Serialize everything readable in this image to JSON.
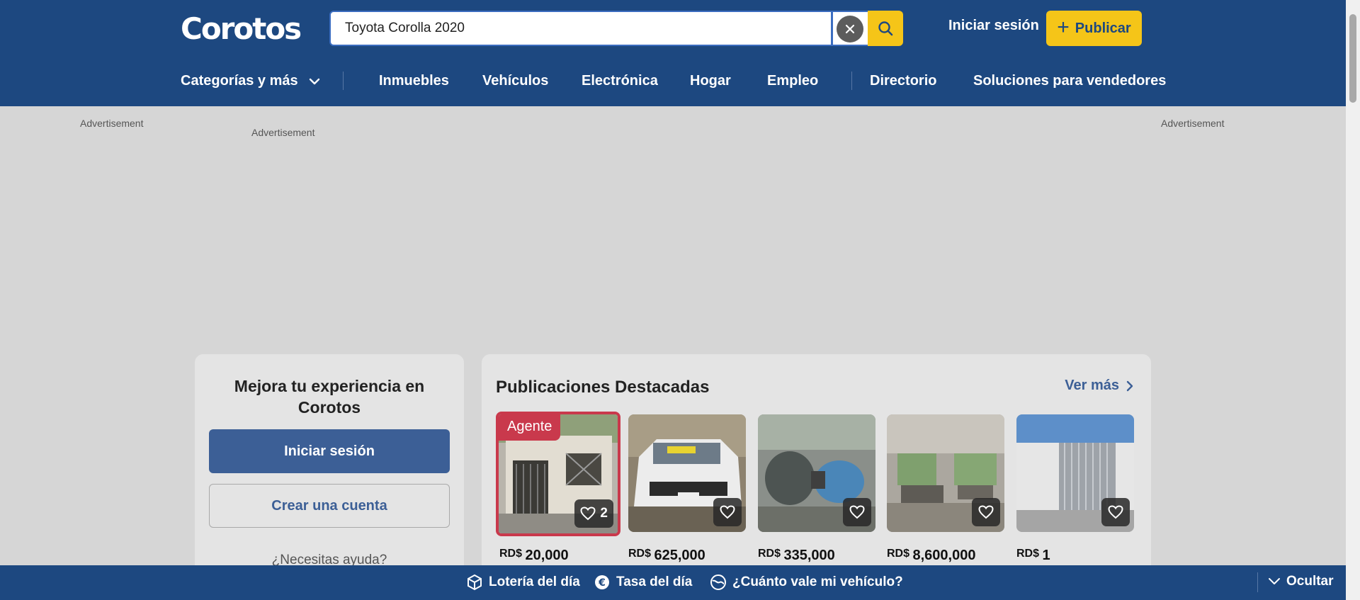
{
  "header": {
    "logo_text": "Corotos",
    "search": {
      "value": "Toyota Corolla 2020",
      "placeholder": ""
    },
    "login_label": "Iniciar sesión",
    "publish_label": "Publicar"
  },
  "nav": {
    "categories_label": "Categorías y más",
    "items": [
      "Inmuebles",
      "Vehículos",
      "Electrónica",
      "Hogar",
      "Empleo",
      "Directorio",
      "Soluciones para vendedores"
    ]
  },
  "ads": {
    "label": "Advertisement"
  },
  "login_card": {
    "title": "Mejora tu experiencia en Corotos",
    "login_button": "Iniciar sesión",
    "register_button": "Crear una cuenta",
    "help_text": "¿Necesitas ayuda?"
  },
  "featured": {
    "title": "Publicaciones Destacadas",
    "see_more": "Ver más",
    "currency": "RD$",
    "agent_badge": "Agente",
    "listings": [
      {
        "price": "20,000",
        "favorites": "2",
        "agent": true,
        "image": "house-facade"
      },
      {
        "price": "625,000",
        "favorites": "",
        "agent": false,
        "image": "white-suv"
      },
      {
        "price": "335,000",
        "favorites": "",
        "agent": false,
        "image": "electric-motors"
      },
      {
        "price": "8,600,000",
        "favorites": "",
        "agent": false,
        "image": "living-room"
      },
      {
        "price": "1",
        "favorites": "",
        "agent": false,
        "image": "white-wall-gate"
      }
    ]
  },
  "bottom_bar": {
    "items": [
      "Lotería del día",
      "Tasa del día",
      "¿Cuánto vale mi vehículo?"
    ],
    "hide_label": "Ocultar"
  },
  "colors": {
    "brand_blue": "#1d4880",
    "accent_yellow": "#f5c518",
    "agent_red": "#c9394c",
    "button_blue": "#3c5f96"
  }
}
